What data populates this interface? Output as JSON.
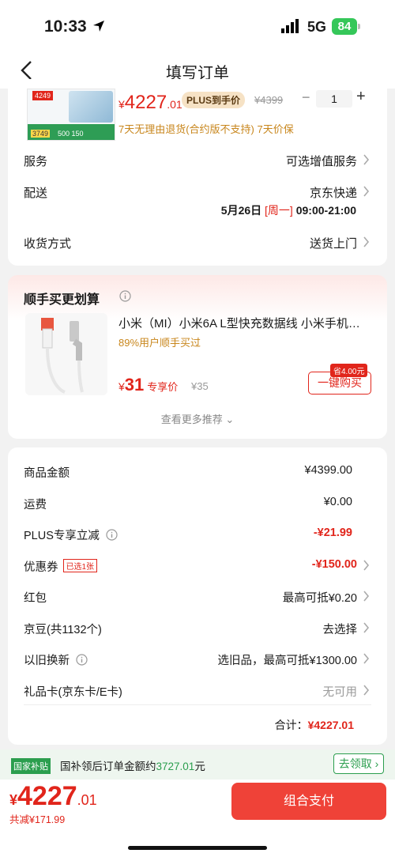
{
  "status_bar": {
    "time": "10:33",
    "network": "5G",
    "battery": "84"
  },
  "nav": {
    "title": "填写订单"
  },
  "product": {
    "thumb_tag_price": "4249",
    "thumb_badge_price": "3749",
    "thumb_badge_mid": "500 150",
    "currency": "¥",
    "price_int": "4227",
    "price_dec": ".01",
    "plus_tag": "PLUS到手价",
    "original_price": "¥4399",
    "quantity": "1",
    "minus_symbol": "−",
    "plus_symbol": "+",
    "policy": "7天无理由退货(合约版不支持)  7天价保"
  },
  "service": {
    "label": "服务",
    "value": "可选增值服务"
  },
  "delivery": {
    "label": "配送",
    "carrier": "京东快递",
    "date": "5月26日",
    "weekday": "[周一]",
    "time": "09:00-21:00"
  },
  "receive": {
    "label": "收货方式",
    "value": "送货上门"
  },
  "recommend": {
    "title": "顺手买更划算",
    "name": "小米（MI）小米6A L型快充数据线 小米手机充电线",
    "percent": "89%用户顺手买过",
    "currency": "¥",
    "price": "31",
    "price_label": "专享价",
    "old_price": "¥35",
    "save_tag": "省4.00元",
    "buy_label": "一键购买",
    "more_label": "查看更多推荐"
  },
  "summary": {
    "goods": {
      "label": "商品金额",
      "value": "¥4399.00"
    },
    "shipping": {
      "label": "运费",
      "value": "¥0.00"
    },
    "plus_discount": {
      "label": "PLUS专享立减",
      "value": "-¥21.99"
    },
    "coupon": {
      "label": "优惠券",
      "tag": "已选1张",
      "value": "-¥150.00"
    },
    "red_packet": {
      "label": "红包",
      "value": "最高可抵¥0.20"
    },
    "jingdou": {
      "label": "京豆(共1132个)",
      "value": "去选择"
    },
    "trade_in": {
      "label": "以旧换新",
      "value": "选旧品，最高可抵¥1300.00"
    },
    "gift_card": {
      "label": "礼品卡(京东卡/E卡)",
      "value": "无可用"
    },
    "total_label": "合计：",
    "total_value": "¥4227.01"
  },
  "subsidy": {
    "tag": "国家补贴",
    "text": "国补领后订单金额约",
    "amount": "3727.01",
    "unit": "元",
    "claim_label": "去领取"
  },
  "bottom": {
    "currency": "¥",
    "amount_int": "4227",
    "amount_dec": ".01",
    "discount": "共减¥171.99",
    "pay_label": "组合支付"
  },
  "colors": {
    "accent": "#e1251b",
    "pay_button": "#ef4238",
    "subsidy_green": "#2b9e4e",
    "policy_gold": "#c8861c"
  }
}
